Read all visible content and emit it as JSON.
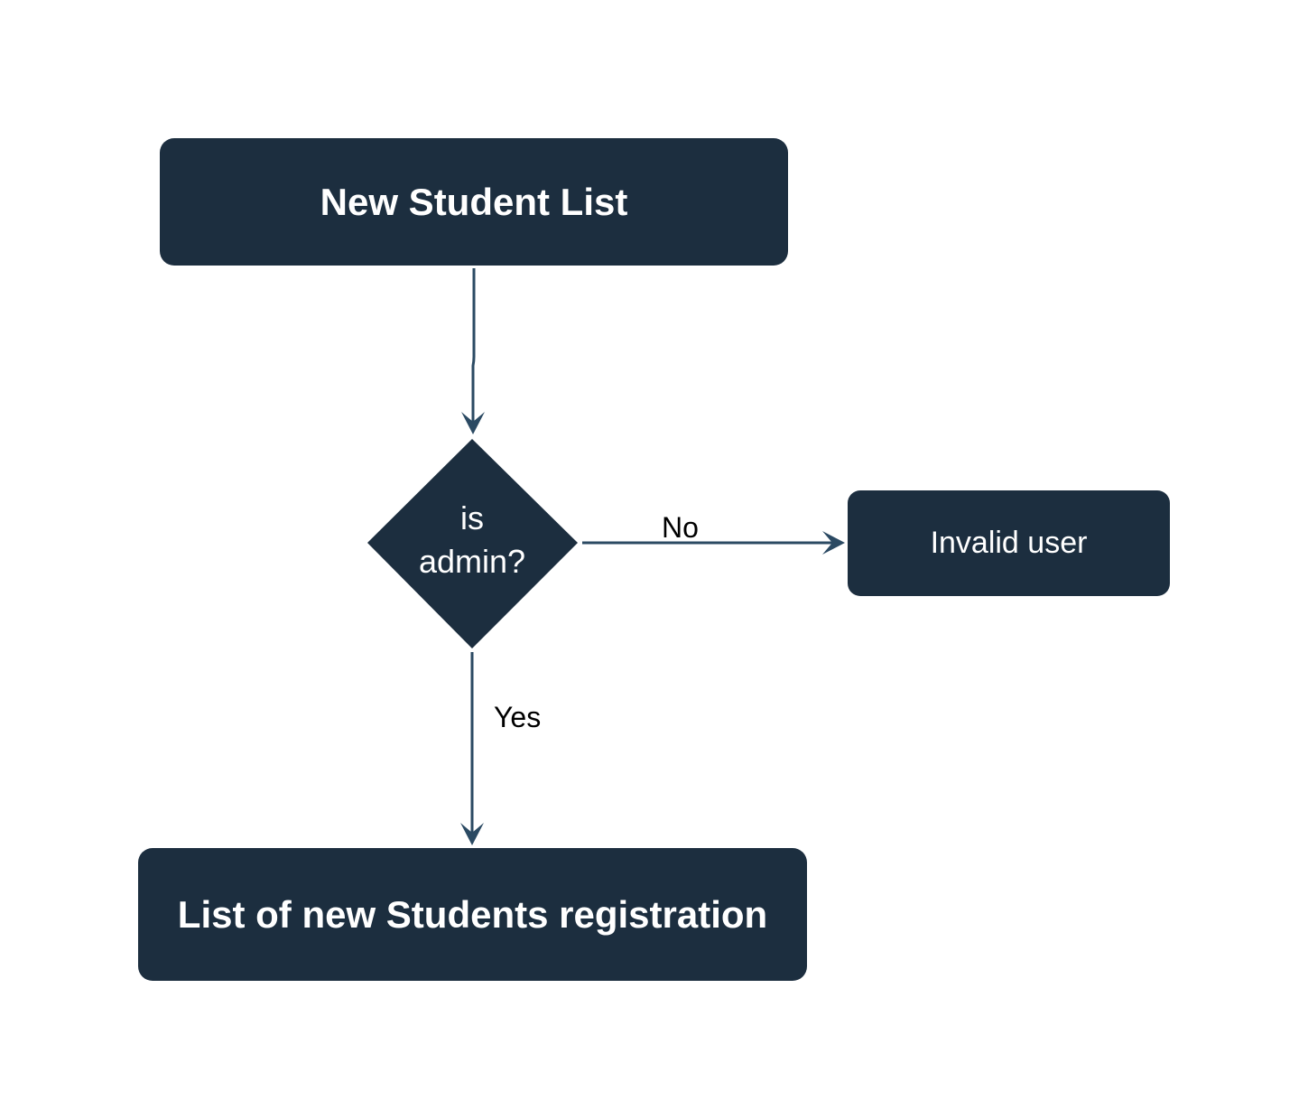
{
  "colors": {
    "node_fill": "#1c2e3f",
    "node_text": "#ffffff",
    "connector": "#2b4a63",
    "edge_label_text": "#000000"
  },
  "nodes": {
    "start": {
      "label": "New Student List"
    },
    "decision": {
      "line1": "is",
      "line2": "admin?"
    },
    "invalid": {
      "label": "Invalid user"
    },
    "end": {
      "label": "List of new Students registration"
    }
  },
  "edges": {
    "no_label": "No",
    "yes_label": "Yes"
  }
}
